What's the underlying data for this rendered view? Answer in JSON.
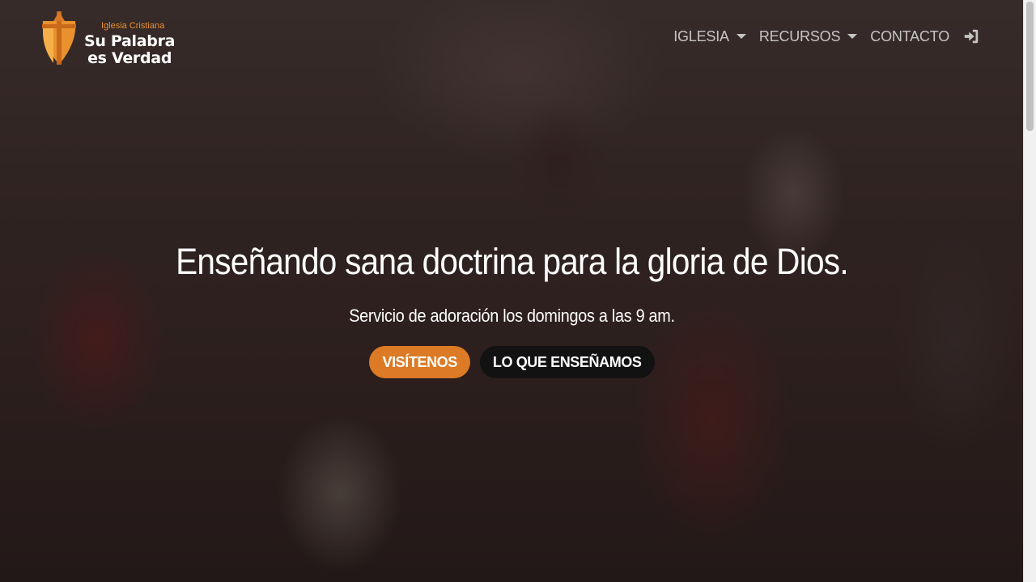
{
  "brand": {
    "small_text": "Iglesia Cristiana",
    "line1": "Su Palabra",
    "line2": "es Verdad"
  },
  "nav": {
    "items": [
      {
        "label": "IGLESIA",
        "dropdown": true
      },
      {
        "label": "RECURSOS",
        "dropdown": true
      },
      {
        "label": "CONTACTO",
        "dropdown": false
      }
    ],
    "login_icon": "sign-in-icon"
  },
  "hero": {
    "title": "Enseñando sana doctrina para la gloria de Dios.",
    "subtitle": "Servicio de adoración los domingos a las 9 am.",
    "primary_button": "VISÍTENOS",
    "secondary_button": "LO QUE ENSEÑAMOS"
  },
  "colors": {
    "accent": "#dc7a25",
    "dark_button": "#121212",
    "nav_text": "#ffffffb8"
  }
}
